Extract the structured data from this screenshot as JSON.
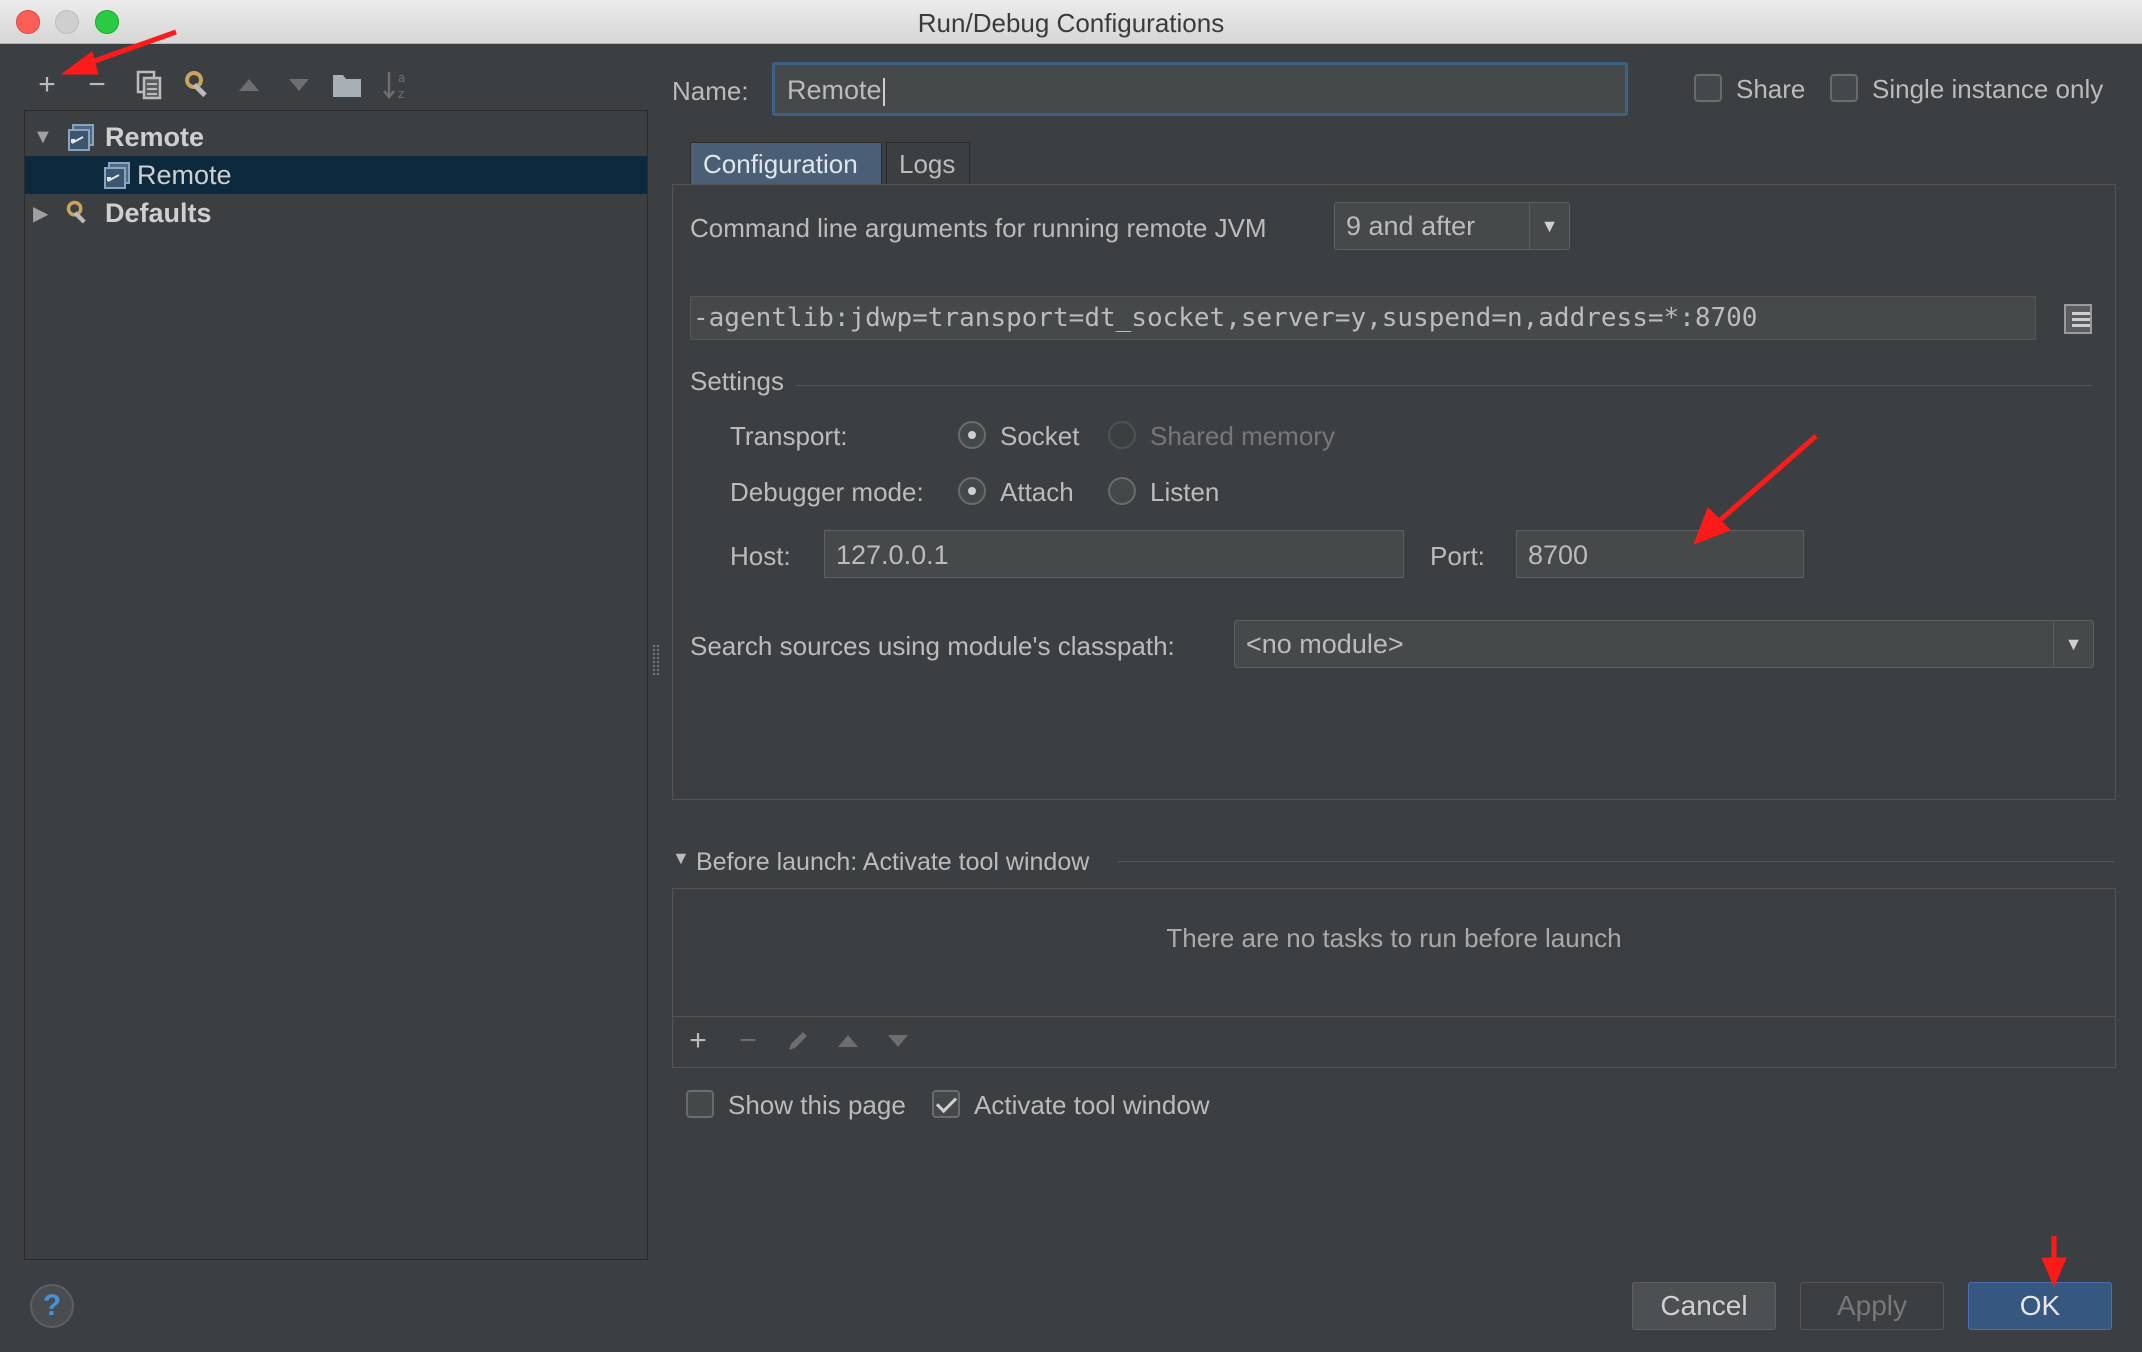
{
  "window": {
    "title": "Run/Debug Configurations",
    "controls": [
      "close",
      "minimize",
      "maximize"
    ]
  },
  "left_toolbar": {
    "icons": [
      "add-icon",
      "remove-icon",
      "copy-config-icon",
      "edit-defaults-icon",
      "move-up-icon",
      "move-down-icon",
      "folder-icon",
      "sort-icon"
    ],
    "add_symbol": "+",
    "remove_symbol": "−"
  },
  "tree": {
    "items": [
      {
        "label": "Remote",
        "level": 0,
        "expanded": true,
        "icon": "remote-icon"
      },
      {
        "label": "Remote",
        "level": 1,
        "selected": true,
        "icon": "remote-icon"
      },
      {
        "label": "Defaults",
        "level": 0,
        "expanded": false,
        "icon": "wrench-icon"
      }
    ]
  },
  "header": {
    "name_label": "Name:",
    "name_value": "Remote",
    "share_label": "Share",
    "share_checked": false,
    "single_instance_label": "Single instance only",
    "single_instance_checked": false
  },
  "tabs": [
    {
      "label": "Configuration",
      "active": true
    },
    {
      "label": "Logs",
      "active": false
    }
  ],
  "configuration": {
    "jvm_args_label": "Command line arguments for running remote JVM",
    "jvm_version_selected": "9 and after",
    "jvm_args_value": "-agentlib:jdwp=transport=dt_socket,server=y,suspend=n,address=*:8700",
    "settings_label": "Settings",
    "transport_label": "Transport:",
    "transport_options": [
      {
        "label": "Socket",
        "selected": true,
        "enabled": true
      },
      {
        "label": "Shared memory",
        "selected": false,
        "enabled": false
      }
    ],
    "debugger_mode_label": "Debugger mode:",
    "debugger_mode_options": [
      {
        "label": "Attach",
        "selected": true
      },
      {
        "label": "Listen",
        "selected": false
      }
    ],
    "host_label": "Host:",
    "host_value": "127.0.0.1",
    "port_label": "Port:",
    "port_value": "8700",
    "classpath_label": "Search sources using module's classpath:",
    "classpath_selected": "<no module>"
  },
  "before_launch": {
    "title": "Before launch: Activate tool window",
    "empty_message": "There are no tasks to run before launch",
    "toolbar_icons": [
      "add-icon",
      "remove-icon",
      "edit-icon",
      "move-up-icon",
      "move-down-icon"
    ],
    "show_page_label": "Show this page",
    "show_page_checked": false,
    "activate_tool_window_label": "Activate tool window",
    "activate_tool_window_checked": true
  },
  "footer": {
    "help_symbol": "?",
    "cancel_label": "Cancel",
    "apply_label": "Apply",
    "ok_label": "OK"
  },
  "colors": {
    "background": "#3c3f41",
    "selection": "#0d293e",
    "accent": "#365880",
    "annotation_arrow": "#ff1a1a"
  }
}
